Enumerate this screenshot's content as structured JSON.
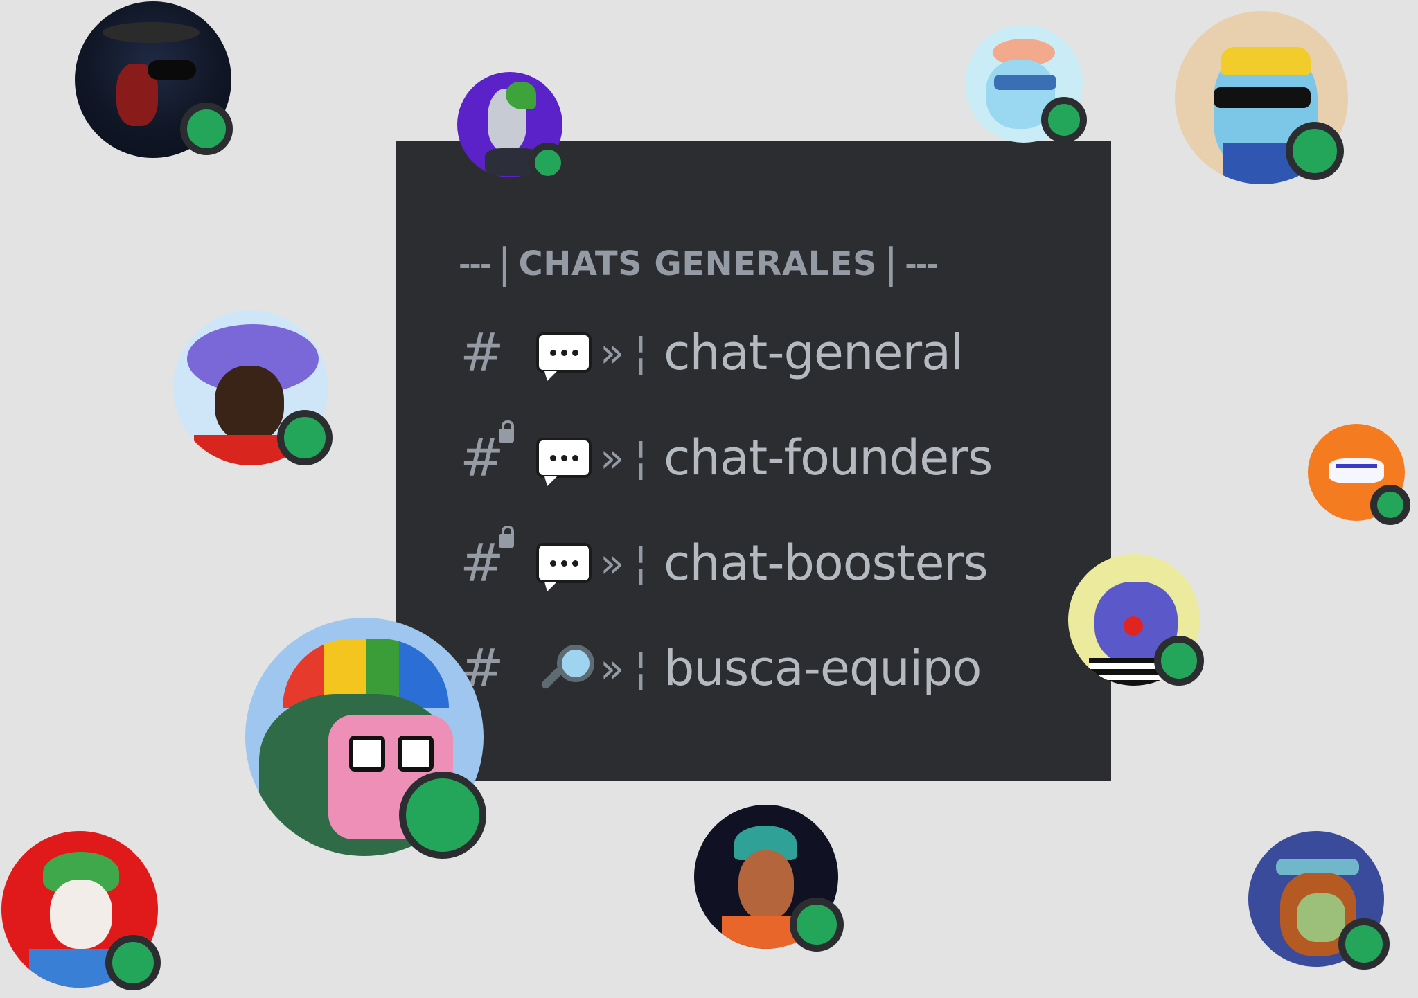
{
  "category": {
    "dashes_left": "---",
    "label": "CHATS GENERALES",
    "dashes_right": "---"
  },
  "channels": [
    {
      "hash": "#",
      "locked": false,
      "emoji": "speech-bubble",
      "arrow": "»",
      "sep": "¦",
      "name": "chat-general"
    },
    {
      "hash": "#",
      "locked": true,
      "emoji": "speech-bubble",
      "arrow": "»",
      "sep": "¦",
      "name": "chat-founders"
    },
    {
      "hash": "#",
      "locked": true,
      "emoji": "speech-bubble",
      "arrow": "»",
      "sep": "¦",
      "name": "chat-boosters"
    },
    {
      "hash": "#",
      "locked": false,
      "emoji": "magnifying-glass",
      "arrow": "»",
      "sep": "¦",
      "name": "busca-equipo"
    }
  ],
  "colors": {
    "background": "#e3e3e3",
    "panel": "#2b2d31",
    "text_muted": "#949ba4",
    "text_channel": "#b5bac1",
    "online": "#23a55a"
  },
  "avatars": [
    {
      "name": "avatar-dark-hat",
      "status": "online"
    },
    {
      "name": "avatar-alien-green-hair",
      "status": "online"
    },
    {
      "name": "avatar-blue-sunglasses",
      "status": "online"
    },
    {
      "name": "avatar-cat-yellow-cap",
      "status": "online"
    },
    {
      "name": "avatar-purple-pigtails",
      "status": "online"
    },
    {
      "name": "avatar-orange-zebra",
      "status": "online"
    },
    {
      "name": "avatar-clown-cat",
      "status": "online"
    },
    {
      "name": "avatar-pixel-monkey",
      "status": "online"
    },
    {
      "name": "avatar-green-hair-character",
      "status": "online"
    },
    {
      "name": "avatar-green-cap-boy",
      "status": "online"
    },
    {
      "name": "avatar-bored-ape",
      "status": "online"
    }
  ]
}
